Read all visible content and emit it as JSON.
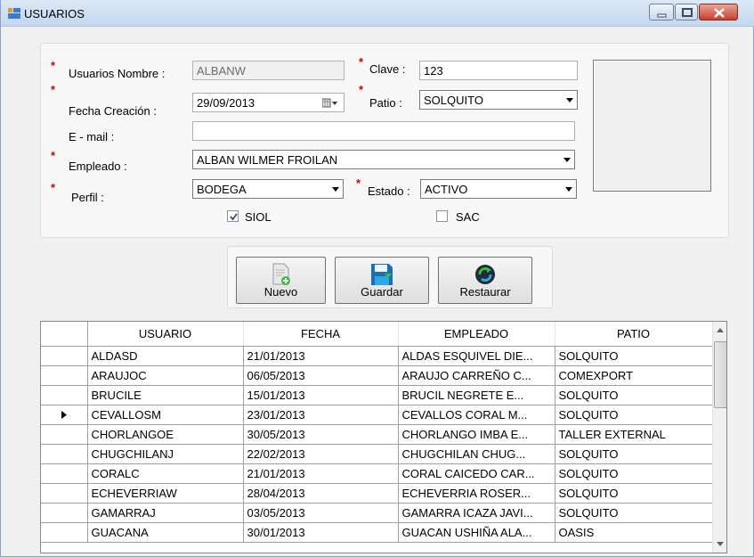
{
  "window": {
    "title": "USUARIOS"
  },
  "form": {
    "usuario_label": "Usuarios Nombre :",
    "usuario_value": "ALBANW",
    "clave_label": "Clave :",
    "clave_value": "123",
    "fecha_label": "Fecha Creación :",
    "fecha_value": "29/09/2013",
    "patio_label": "Patio :",
    "patio_value": "SOLQUITO",
    "email_label": "E - mail :",
    "email_value": "",
    "empleado_label": "Empleado :",
    "empleado_value": "ALBAN WILMER FROILAN",
    "perfil_label": "Perfil :",
    "perfil_value": "BODEGA",
    "estado_label": "Estado :",
    "estado_value": "ACTIVO",
    "siol_label": "SIOL",
    "siol_checked": true,
    "sac_label": "SAC",
    "sac_checked": false,
    "required_mark": "*"
  },
  "buttons": {
    "nuevo": "Nuevo",
    "guardar": "Guardar",
    "restaurar": "Restaurar"
  },
  "table": {
    "columns": [
      "USUARIO",
      "FECHA",
      "EMPLEADO",
      "PATIO"
    ],
    "current_row_index": 3,
    "rows": [
      [
        "ALDASD",
        "21/01/2013",
        "ALDAS ESQUIVEL DIE...",
        "SOLQUITO"
      ],
      [
        "ARAUJOC",
        "06/05/2013",
        "ARAUJO CARREÑO C...",
        "COMEXPORT"
      ],
      [
        "BRUCILE",
        "15/01/2013",
        "BRUCIL NEGRETE E...",
        "SOLQUITO"
      ],
      [
        "CEVALLOSM",
        "23/01/2013",
        "CEVALLOS CORAL M...",
        "SOLQUITO"
      ],
      [
        "CHORLANGOE",
        "30/05/2013",
        "CHORLANGO IMBA E...",
        "TALLER EXTERNAL"
      ],
      [
        "CHUGCHILANJ",
        "22/02/2013",
        "CHUGCHILAN CHUG...",
        "SOLQUITO"
      ],
      [
        "CORALC",
        "21/01/2013",
        "CORAL CAICEDO CAR...",
        "SOLQUITO"
      ],
      [
        "ECHEVERRIAW",
        "28/04/2013",
        "ECHEVERRIA ROSER...",
        "SOLQUITO"
      ],
      [
        "GAMARRAJ",
        "03/05/2013",
        "GAMARRA ICAZA JAVI...",
        "SOLQUITO"
      ],
      [
        "GUACANA",
        "30/01/2013",
        "GUACAN USHIÑA ALA...",
        "OASIS"
      ]
    ]
  }
}
